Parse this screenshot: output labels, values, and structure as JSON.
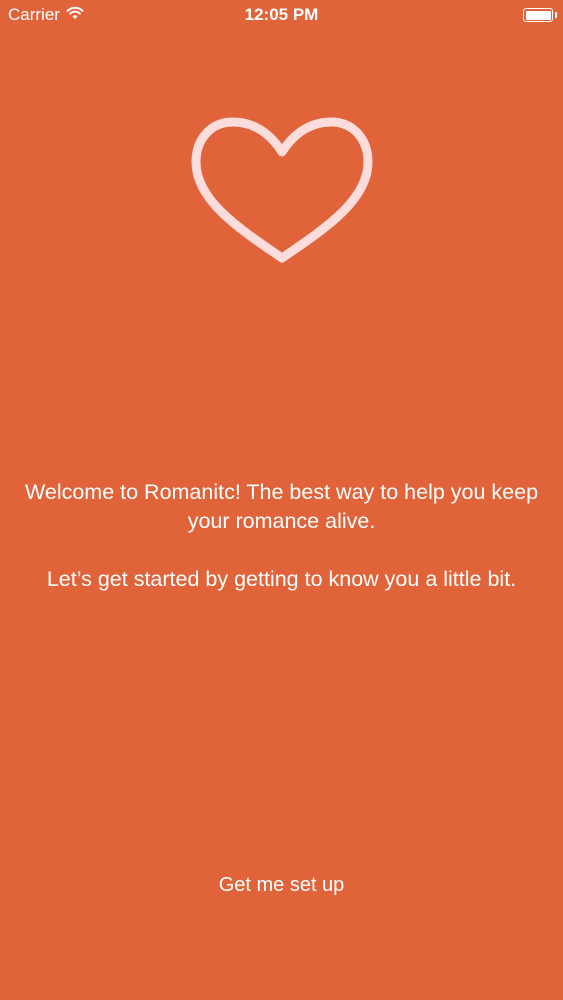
{
  "status_bar": {
    "carrier": "Carrier",
    "wifi_icon": "wifi-icon",
    "time": "12:05 PM",
    "battery_icon": "battery-icon",
    "battery_level": 1.0
  },
  "hero": {
    "icon": "heart-outline-icon",
    "icon_color": "#FDDCDC"
  },
  "welcome": {
    "line1": "Welcome to Romanitc! The best way to help you keep your romance alive.",
    "line2": "Let’s get started by getting to know you a little bit."
  },
  "cta": {
    "label": "Get me set up"
  },
  "colors": {
    "background": "#E0633A",
    "text": "#FFFFFF"
  }
}
